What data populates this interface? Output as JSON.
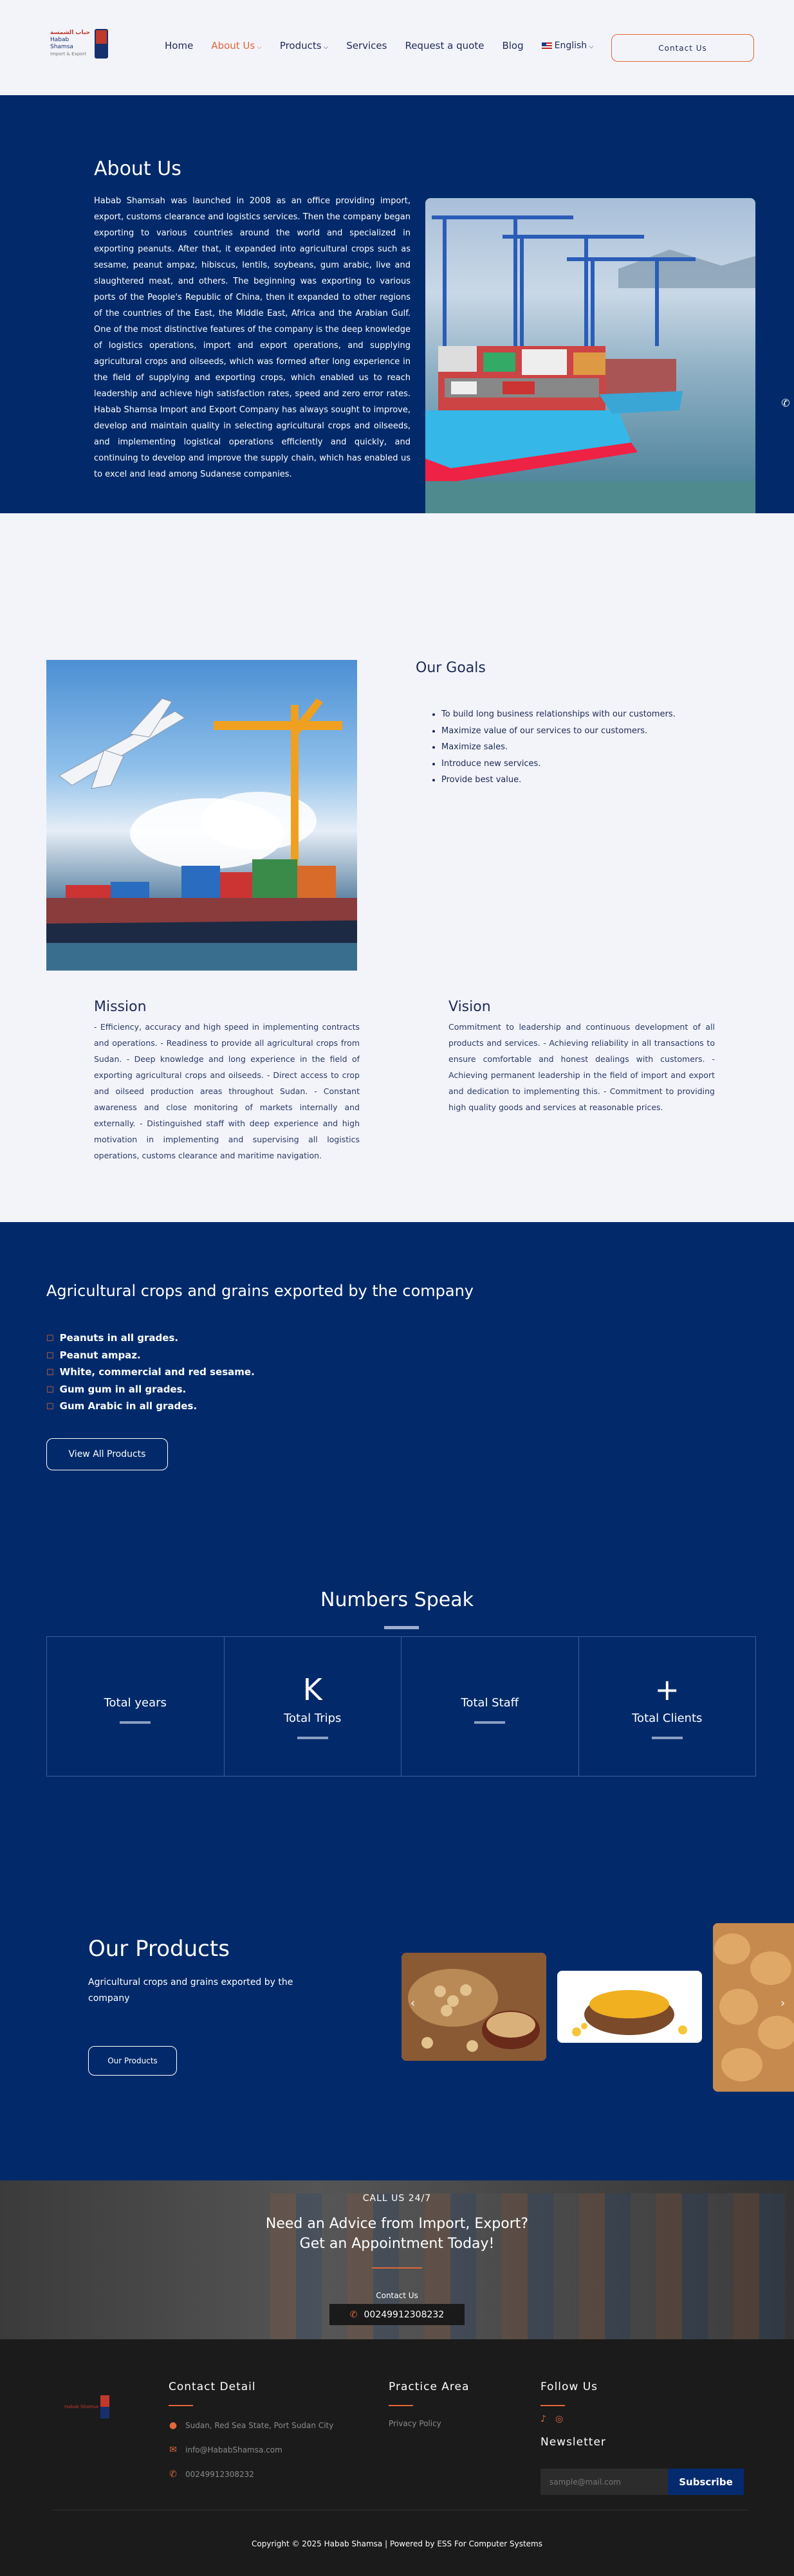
{
  "header": {
    "logo_text_ar": "حباب الشمسة",
    "logo_text_en": "Habab Shamsa",
    "logo_tagline": "Import & Export",
    "nav": [
      {
        "label": "Home",
        "dropdown": false,
        "active": false
      },
      {
        "label": "About Us",
        "dropdown": true,
        "active": true
      },
      {
        "label": "Products",
        "dropdown": true,
        "active": false
      },
      {
        "label": "Services",
        "dropdown": false,
        "active": false
      },
      {
        "label": "Request a quote",
        "dropdown": false,
        "active": false
      },
      {
        "label": "Blog",
        "dropdown": false,
        "active": false
      }
    ],
    "language": "English",
    "contact_button": "Contact Us"
  },
  "about": {
    "title": "About Us",
    "text": "Habab Shamsah was launched in 2008 as an office providing import, export, customs clearance and logistics services. Then the company began exporting to various countries around the world and specialized in exporting peanuts. After that, it expanded into agricultural crops such as sesame, peanut ampaz, hibiscus, lentils, soybeans, gum arabic, live and slaughtered meat, and others. The beginning was exporting to various ports of the People's Republic of China, then it expanded to other regions of the countries of the East, the Middle East, Africa and the Arabian Gulf. One of the most distinctive features of the company is the deep knowledge of logistics operations, import and export operations, and supplying agricultural crops and oilseeds, which was formed after long experience in the field of supplying and exporting crops, which enabled us to reach leadership and achieve high satisfaction rates, speed and zero error rates. Habab Shamsa Import and Export Company has always sought to improve, develop and maintain quality in selecting agricultural crops and oilseeds, and implementing logistical operations efficiently and quickly, and continuing to develop and improve the supply chain, which has enabled us to excel and lead among Sudanese companies."
  },
  "goals": {
    "title": "Our Goals",
    "items": [
      "To build long business relationships with our customers.",
      "Maximize value of our services to our customers.",
      "Maximize sales.",
      "Introduce new services.",
      "Provide best value."
    ]
  },
  "mission": {
    "title": "Mission",
    "text": "- Efficiency, accuracy and high speed in implementing contracts and operations. - Readiness to provide all agricultural crops from Sudan. - Deep knowledge and long experience in the field of exporting agricultural crops and oilseeds. - Direct access to crop and oilseed production areas throughout Sudan. - Constant awareness and close monitoring of markets internally and externally. - Distinguished staff with deep experience and high motivation in implementing and supervising all logistics operations, customs clearance and maritime navigation."
  },
  "vision": {
    "title": "Vision",
    "text": "Commitment to leadership and continuous development of all products and services. - Achieving reliability in all transactions to ensure comfortable and honest dealings with customers. - Achieving permanent leadership in the field of import and export and dedication to implementing this. - Commitment to providing high quality goods and services at reasonable prices."
  },
  "crops": {
    "title": "Agricultural crops and grains exported by the company",
    "items": [
      "Peanuts in all grades.",
      "Peanut ampaz.",
      "White, commercial and red sesame.",
      "Gum gum in all grades.",
      "Gum Arabic in all grades."
    ],
    "button": "View All Products"
  },
  "numbers": {
    "title": "Numbers Speak",
    "cells": [
      {
        "big": "",
        "label": "Total years"
      },
      {
        "big": "K",
        "label": "Total Trips"
      },
      {
        "big": "",
        "label": "Total Staff"
      },
      {
        "big": "+",
        "label": "Total Clients"
      }
    ]
  },
  "products": {
    "title": "Our Products",
    "text": "Agricultural crops and grains exported by the company",
    "button": "Our Products"
  },
  "cta": {
    "kicker": "CALL US 24/7",
    "title_line1": "Need an Advice from Import, Export?",
    "title_line2": "Get an Appointment Today!",
    "contact_link": "Contact Us",
    "phone": "00249912308232"
  },
  "footer": {
    "contact_title": "Contact Detail",
    "address": "Sudan, Red Sea State, Port Sudan City",
    "email": "info@HababShamsa.com",
    "phone": "00249912308232",
    "practice_title": "Practice Area",
    "practice_item": "Privacy Policy",
    "follow_title": "Follow Us",
    "newsletter_title": "Newsletter",
    "newsletter_placeholder": "sample@mail.com",
    "subscribe": "Subscribe",
    "copyright": "Copyright © 2025 Habab Shamsa | Powered by ESS For Computer Systems"
  },
  "colors": {
    "navy": "#022a6a",
    "accent": "#e0673b",
    "footer_bg": "#1b1b1b",
    "page_bg": "#f3f4fa"
  }
}
